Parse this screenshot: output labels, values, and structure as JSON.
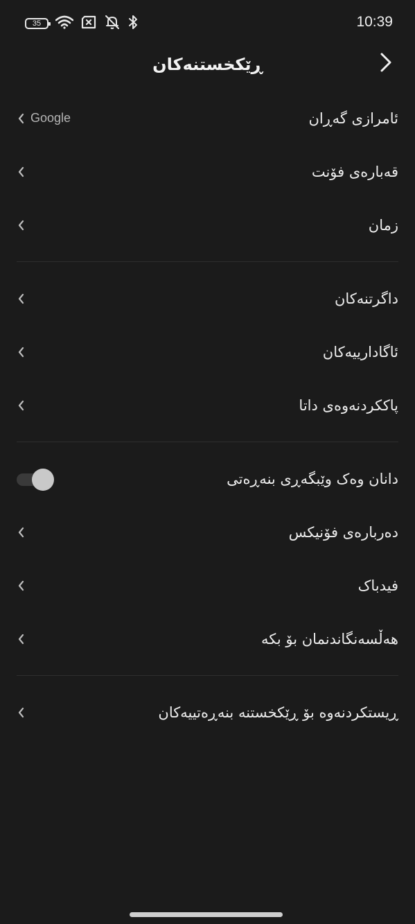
{
  "status_bar": {
    "battery_level": "35",
    "time": "10:39",
    "icons": [
      "battery-icon",
      "wifi-icon",
      "sim-x-icon",
      "muted-bell-icon",
      "bluetooth-icon"
    ]
  },
  "header": {
    "title": "ڕێکخستنەکان",
    "back_icon": "chevron-right-icon"
  },
  "groups": [
    {
      "items": [
        {
          "label": "ئامرازی گەڕان",
          "value": "Google"
        },
        {
          "label": "قەبارەی فۆنت"
        },
        {
          "label": "زمان"
        }
      ]
    },
    {
      "items": [
        {
          "label": "داگرتنەکان"
        },
        {
          "label": "ئاگادارییەکان"
        },
        {
          "label": "پاککردنەوەی داتا"
        }
      ]
    },
    {
      "items": [
        {
          "label": "دانان وەک وێبگەڕی بنەڕەتی",
          "toggle": false
        },
        {
          "label": "دەربارەی فۆنیکس"
        },
        {
          "label": "فیدباک"
        },
        {
          "label": "هەڵسەنگاندنمان بۆ بکە"
        }
      ]
    },
    {
      "items": [
        {
          "label": "ڕیستکردنەوە بۆ ڕێکخستنە بنەڕەتییەکان"
        }
      ]
    }
  ],
  "colors": {
    "background": "#1b1b1b",
    "text": "#ececec",
    "secondary_text": "#b5b5b5",
    "divider": "#2e2e2e"
  }
}
